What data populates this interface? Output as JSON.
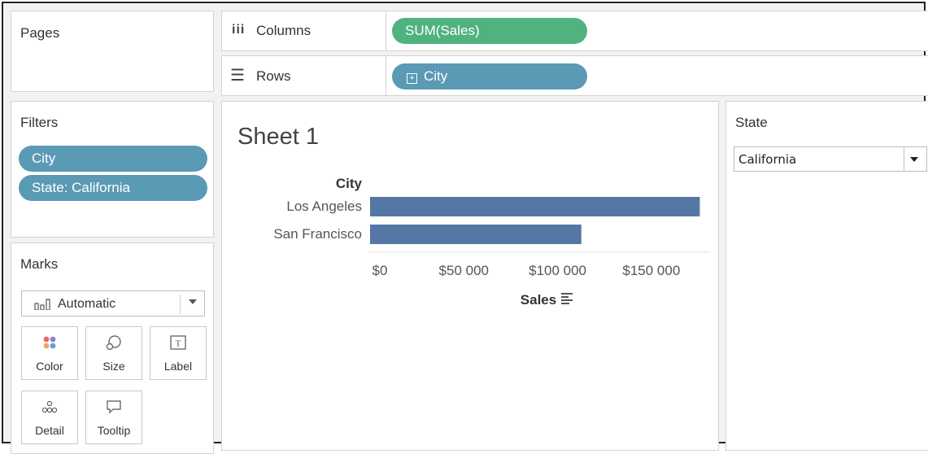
{
  "shelves": {
    "columns_label": "Columns",
    "columns_pill": "SUM(Sales)",
    "rows_label": "Rows",
    "rows_pill": "City"
  },
  "pages": {
    "title": "Pages"
  },
  "filters": {
    "title": "Filters",
    "items": [
      "City",
      "State: California"
    ]
  },
  "marks": {
    "title": "Marks",
    "type_selected": "Automatic",
    "cards": [
      "Color",
      "Size",
      "Label",
      "Detail",
      "Tooltip"
    ]
  },
  "state_filter": {
    "title": "State",
    "selected": "California"
  },
  "sheet": {
    "title": "Sheet 1"
  },
  "colors": {
    "bar": "#5577a5",
    "pill_blue": "#5a9ab5",
    "pill_green": "#4fb27f"
  },
  "chart_data": {
    "type": "bar",
    "orientation": "horizontal",
    "row_header": "City",
    "categories": [
      "Los Angeles",
      "San Francisco"
    ],
    "values": [
      175851,
      112670
    ],
    "xlabel": "Sales",
    "xticks": [
      "$0",
      "$50 000",
      "$100 000",
      "$150 000"
    ],
    "xtick_values": [
      0,
      50000,
      100000,
      150000
    ],
    "xlim": [
      0,
      180000
    ],
    "grid": false
  }
}
